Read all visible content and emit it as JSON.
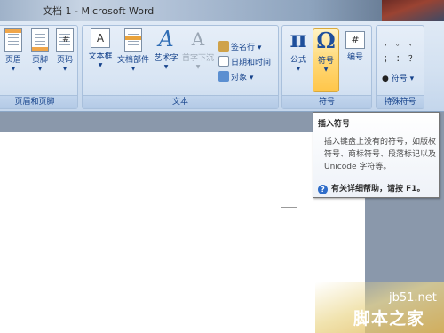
{
  "window": {
    "title": "文档 1 - Microsoft Word"
  },
  "ribbon": {
    "groups": [
      {
        "label": "页眉和页脚",
        "buttons": [
          "页眉",
          "页脚",
          "页码"
        ]
      },
      {
        "label": "文本",
        "buttons": [
          "文本框",
          "文档部件",
          "艺术字",
          "首字下沉"
        ],
        "small_buttons": [
          "签名行",
          "日期和时间",
          "对象"
        ]
      },
      {
        "label": "符号",
        "buttons": [
          "公式",
          "符号",
          "编号"
        ]
      },
      {
        "label": "特殊符号",
        "symbols": [
          "，",
          "。",
          "、",
          "；",
          "：",
          "？"
        ],
        "more_label": "符号"
      }
    ],
    "icons": {
      "pi": "π",
      "omega": "Ω",
      "hash": "#",
      "art_a": "A"
    }
  },
  "tooltip": {
    "title": "插入符号",
    "body": "插入键盘上没有的符号，如版权符号、商标符号、段落标记以及 Unicode 字符等。",
    "help": "有关详细帮助，请按 F1。",
    "help_icon": "?"
  },
  "watermark": {
    "site": "jb51.net",
    "name": "脚本之家"
  },
  "colors": {
    "accent": "#15428b",
    "hot": "#ffc64a",
    "ribbon": "#d3e1f1"
  }
}
